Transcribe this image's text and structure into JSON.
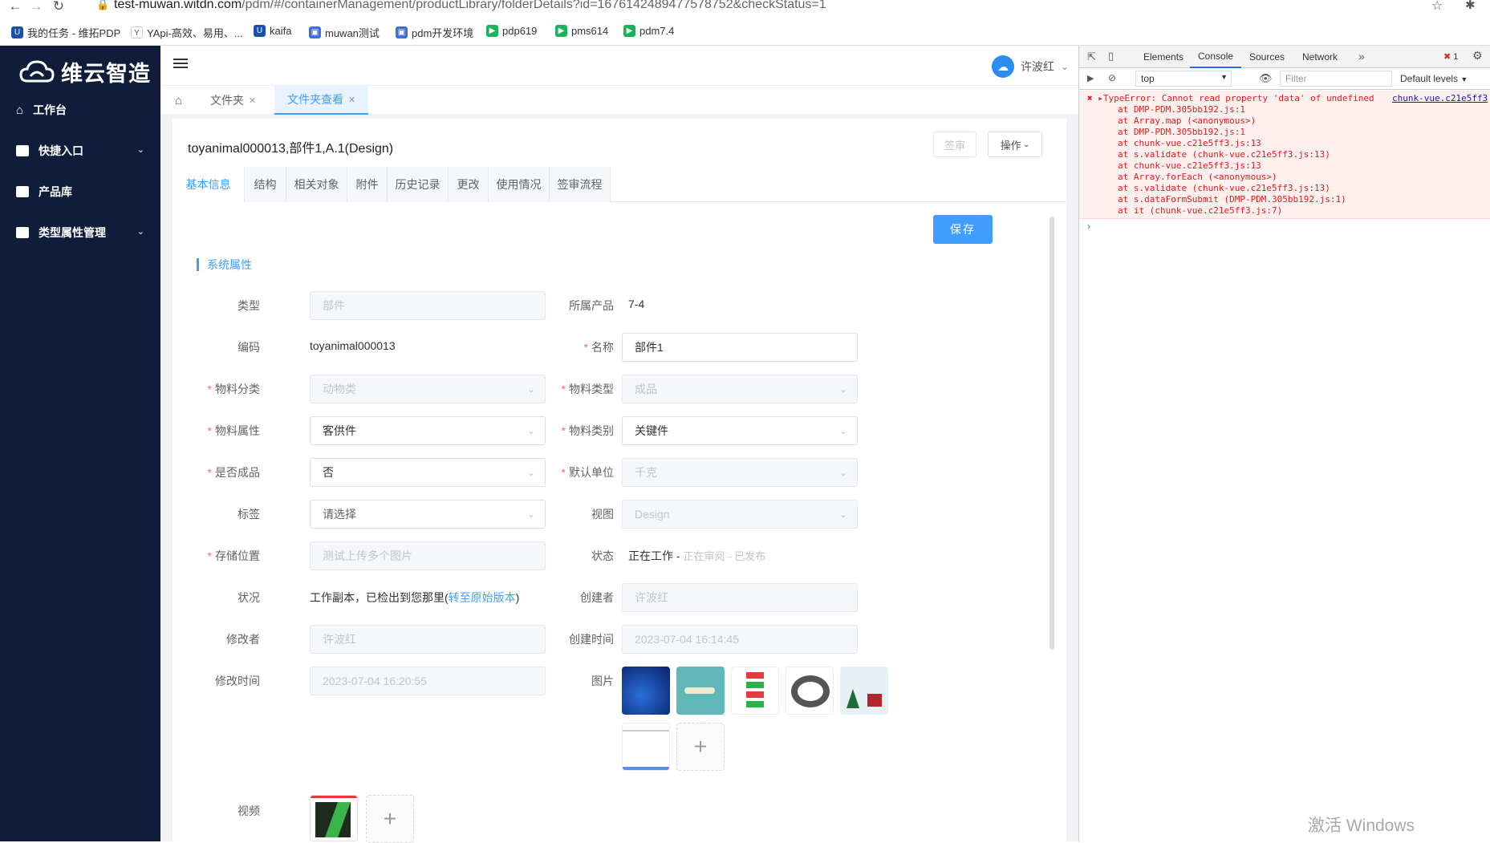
{
  "browser": {
    "url_host": "test-muwan.witdn.com",
    "url_path": "/pdm/#/containerManagement/productLibrary/folderDetails?id=1676142489477578752&checkStatus=1",
    "bookmarks": [
      "我的任务 - 维拓PDP",
      "YApi-高效、易用、...",
      "kaifa",
      "muwan测试",
      "pdm开发环境",
      "pdp619",
      "pms614",
      "pdm7.4"
    ]
  },
  "sidebar": {
    "logo_text": "维云智造",
    "items": [
      {
        "label": "工作台",
        "icon": "home-icon"
      },
      {
        "label": "快捷入口",
        "icon": "clipboard-icon",
        "expandable": true
      },
      {
        "label": "产品库",
        "icon": "chart-icon"
      },
      {
        "label": "类型属性管理",
        "icon": "monitor-icon",
        "expandable": true
      }
    ]
  },
  "header": {
    "user_name": "许波红"
  },
  "tabs": [
    {
      "label": "文件夹"
    },
    {
      "label": "文件夹查看",
      "active": true
    }
  ],
  "document": {
    "title": "toyanimal000013,部件1,A.1(Design)",
    "sign_label": "签审",
    "op_label": "操作",
    "save_label": "保存"
  },
  "subtabs": [
    "基本信息",
    "结构",
    "相关对象",
    "附件",
    "历史记录",
    "更改",
    "使用情况",
    "签审流程"
  ],
  "section_title": "系统属性",
  "form": {
    "type_label": "类型",
    "type_value": "部件",
    "product_label": "所属产品",
    "product_value": "7-4",
    "code_label": "编码",
    "code_value": "toyanimal000013",
    "name_label": "名称",
    "name_value": "部件1",
    "mat_class_label": "物料分类",
    "mat_class_value": "动物类",
    "mat_type_label": "物料类型",
    "mat_type_value": "成品",
    "mat_attr_label": "物料属性",
    "mat_attr_value": "客供件",
    "mat_cat_label": "物料类别",
    "mat_cat_value": "关键件",
    "finished_label": "是否成品",
    "finished_value": "否",
    "unit_label": "默认单位",
    "unit_value": "千克",
    "tag_label": "标签",
    "tag_placeholder": "请选择",
    "view_label": "视图",
    "view_value": "Design",
    "storage_label": "存储位置",
    "storage_value": "测试上传多个图片",
    "state_label": "状态",
    "state_current": "正在工作 -",
    "state_review": "正在审阅 -",
    "state_released": "已发布",
    "cond_label": "状况",
    "cond_text": "工作副本，已检出到您那里(",
    "cond_link": "转至原始版本",
    "cond_end": ")",
    "creator_label": "创建者",
    "creator_value": "许波红",
    "modifier_label": "修改者",
    "modifier_value": "许波红",
    "created_label": "创建时间",
    "created_value": "2023-07-04 16:14:45",
    "modified_label": "修改时间",
    "modified_value": "2023-07-04 16:20:55",
    "image_label": "图片",
    "video_label": "视频"
  },
  "devtools": {
    "tabs": [
      "Elements",
      "Console",
      "Sources",
      "Network"
    ],
    "error_count": "1",
    "context": "top",
    "filter_placeholder": "Filter",
    "levels": "Default levels",
    "error_lines": [
      "TypeError: Cannot read property 'data' of undefined",
      "at DMP-PDM.305bb192.js:1",
      "at Array.map (<anonymous>)",
      "at DMP-PDM.305bb192.js:1",
      "at chunk-vue.c21e5ff3.js:13",
      "at s.validate (chunk-vue.c21e5ff3.js:13)",
      "at chunk-vue.c21e5ff3.js:13",
      "at Array.forEach (<anonymous>)",
      "at s.validate (chunk-vue.c21e5ff3.js:13)",
      "at s.dataFormSubmit (DMP-PDM.305bb192.js:1)",
      "at it (chunk-vue.c21e5ff3.js:7)"
    ],
    "error_source": "chunk-vue.c21e5ff3"
  },
  "watermark": "激活 Windows"
}
